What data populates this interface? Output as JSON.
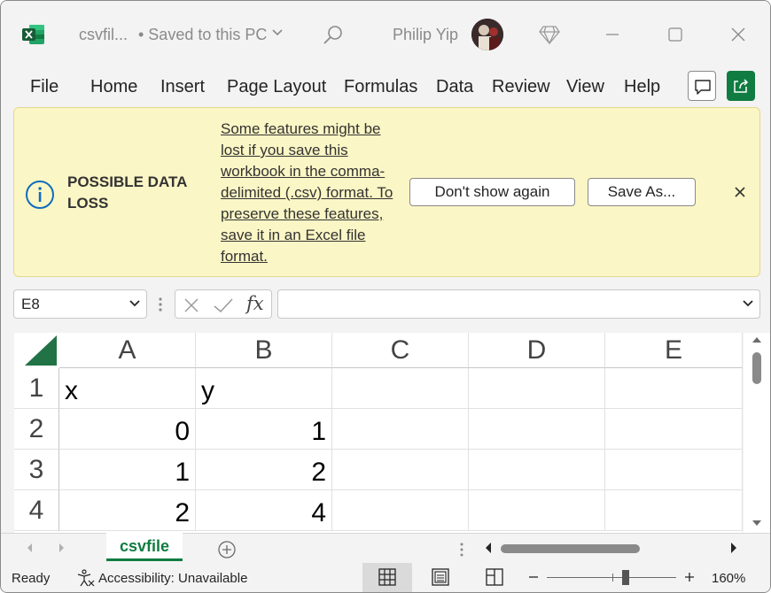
{
  "titlebar": {
    "doc_title": "csvfil...",
    "save_status": "• Saved to this PC",
    "user_name": "Philip Yip"
  },
  "ribbon": {
    "tabs": [
      "File",
      "Home",
      "Insert",
      "Page Layout",
      "Formulas",
      "Data",
      "Review",
      "View",
      "Help"
    ]
  },
  "message_bar": {
    "title": "POSSIBLE DATA LOSS",
    "text": "Some features might be lost if you save this workbook in the comma-delimited (.csv) format. To preserve these features, save it in an Excel file format.",
    "dont_show_label": "Don't show again",
    "save_as_label": "Save As..."
  },
  "formula_bar": {
    "name_box": "E8",
    "fx_label": "fx",
    "formula_value": ""
  },
  "grid": {
    "columns": [
      "A",
      "B",
      "C",
      "D",
      "E"
    ],
    "rows": [
      {
        "label": "1",
        "cells": [
          "x",
          "y",
          "",
          "",
          ""
        ]
      },
      {
        "label": "2",
        "cells": [
          "0",
          "1",
          "",
          "",
          ""
        ]
      },
      {
        "label": "3",
        "cells": [
          "1",
          "2",
          "",
          "",
          ""
        ]
      },
      {
        "label": "4",
        "cells": [
          "2",
          "4",
          "",
          "",
          ""
        ]
      }
    ]
  },
  "sheets": {
    "active": "csvfile"
  },
  "status": {
    "ready": "Ready",
    "accessibility": "Accessibility: Unavailable",
    "zoom_level": "160%",
    "zoom_value": 160
  },
  "colors": {
    "accent": "#107c41",
    "message_bg": "#fbf6c5",
    "info_icon": "#0f6cbd"
  }
}
